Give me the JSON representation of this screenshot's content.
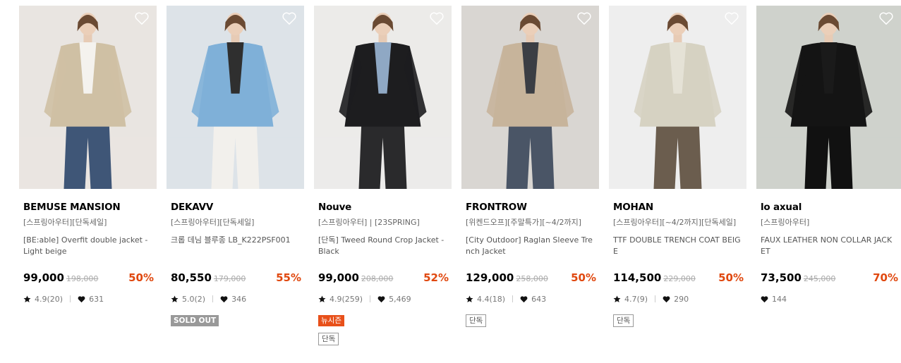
{
  "products": [
    {
      "brand": "BEMUSE MANSION",
      "categories": "[스프링아우터][단독세일]",
      "name": "[BE:able] Overfit double jacket - Light beige",
      "price": "99,000",
      "original_price": "198,000",
      "discount": "50%",
      "rating": "4.9(20)",
      "likes": "631",
      "tags": [],
      "photo": {
        "bg": "#e9e5e1",
        "garment": "#cfc0a4",
        "inner": "#f4f2ee",
        "bottom": "#3f5677"
      }
    },
    {
      "brand": "DEKAVV",
      "categories": "[스프링아우터][단독세일]",
      "name": "크롭 데님 블루종 LB_K222PSF001",
      "price": "80,550",
      "original_price": "179,000",
      "discount": "55%",
      "rating": "5.0(2)",
      "likes": "346",
      "tags": [
        "SOLD OUT"
      ],
      "photo": {
        "bg": "#dde3e8",
        "garment": "#7fb0d8",
        "inner": "#2f2f2f",
        "bottom": "#f2f0ec"
      }
    },
    {
      "brand": "Nouve",
      "categories": "[스프링아우터] | [23SPRING]",
      "name": "[단독] Tweed Round Crop Jacket - Black",
      "price": "99,000",
      "original_price": "208,000",
      "discount": "52%",
      "rating": "4.9(259)",
      "likes": "5,469",
      "tags": [
        "뉴시즌",
        "단독"
      ],
      "photo": {
        "bg": "#ecebe9",
        "garment": "#1d1d1f",
        "inner": "#8fa8c4",
        "bottom": "#2a2a2c"
      }
    },
    {
      "brand": "FRONTROW",
      "categories": "[위켄드오프][주말특가][~4/2까지]",
      "name": "[City Outdoor] Raglan Sleeve Trench Jacket",
      "price": "129,000",
      "original_price": "258,000",
      "discount": "50%",
      "rating": "4.4(18)",
      "likes": "643",
      "tags": [
        "단독"
      ],
      "photo": {
        "bg": "#d9d6d2",
        "garment": "#c7b49b",
        "inner": "#3b3e44",
        "bottom": "#4a5566"
      }
    },
    {
      "brand": "MOHAN",
      "categories": "[스프링아우터][~4/2까지][단독세일]",
      "name": "TTF DOUBLE TRENCH COAT BEIGE",
      "price": "114,500",
      "original_price": "229,000",
      "discount": "50%",
      "rating": "4.7(9)",
      "likes": "290",
      "tags": [
        "단독"
      ],
      "photo": {
        "bg": "#eeeeee",
        "garment": "#d6d2c2",
        "inner": "#e5e2d6",
        "bottom": "#6b5d4e"
      }
    },
    {
      "brand": "lo axual",
      "categories": "[스프링아우터]",
      "name": "FAUX LEATHER NON COLLAR JACKET",
      "price": "73,500",
      "original_price": "245,000",
      "discount": "70%",
      "rating": "",
      "likes": "144",
      "tags": [],
      "photo": {
        "bg": "#cfd2cc",
        "garment": "#141414",
        "inner": "#1a1a1a",
        "bottom": "#111111"
      }
    }
  ],
  "colors": {
    "accent": "#e0480f",
    "newseason": "#e8501a",
    "soldout": "#999999"
  },
  "icons": {
    "star": "star-icon",
    "like": "heart-icon",
    "wishlist": "heart-outline-icon"
  }
}
